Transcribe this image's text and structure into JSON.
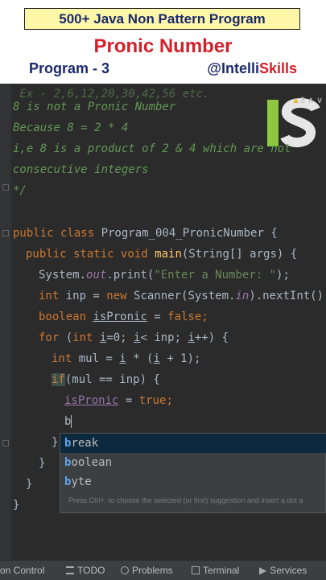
{
  "banner": {
    "series_title": "500+ Java Non Pattern Program",
    "topic_title": "Pronic Number",
    "program_label": "Program - 3",
    "handle_prefix": "@Intelli",
    "handle_suffix": "Skills"
  },
  "editor": {
    "comment_lines": [
      "8 is not a Pronic Number",
      "Because 8 = 2 * 4",
      "i,e 8 is a product of 2 & 4 which are not",
      "consecutive integers",
      "*/"
    ],
    "code": {
      "class_kw": "public class ",
      "class_name": "Program_004_PronicNumber {",
      "main_kw": "public static void ",
      "main_name": "main",
      "main_args": "(String[] args) {",
      "print_obj": "System.",
      "print_field": "out",
      "print_call": ".print(",
      "print_str": "\"Enter a Number: \"",
      "print_end": ");",
      "int_kw": "int ",
      "inp_decl": "inp = ",
      "new_kw": "new ",
      "scanner": "Scanner(System.",
      "in_field": "in",
      "scanner_end": ").nextInt();",
      "bool_kw": "boolean ",
      "is_pronic": "isPronic",
      "eq": " = ",
      "false_kw": "false",
      "semi": ";",
      "for_kw": "for ",
      "for_open": "(",
      "for_int": "int ",
      "for_i": "i",
      "for_init": "=0; ",
      "for_cond": "< inp; ",
      "for_inc": "++) {",
      "mul_decl": "mul = ",
      "mul_i": "i",
      "mul_rest1": " * (",
      "mul_i2": "i",
      "mul_rest2": " + 1);",
      "if_kw": "if",
      "if_cond": "(mul == inp) {",
      "assign_var": "isPronic",
      "assign_eq": " = ",
      "true_kw": "true",
      "assign_end": ";",
      "typed": "b",
      "close_brace": "}"
    },
    "badge_count": "3",
    "logo_text": "IS"
  },
  "autocomplete": {
    "items": [
      {
        "match": "b",
        "rest": "reak"
      },
      {
        "match": "b",
        "rest": "oolean"
      },
      {
        "match": "b",
        "rest": "yte"
      }
    ],
    "hint": "Press Ctrl+. to choose the selected (or first) suggestion and insert a dot a"
  },
  "statusbar": {
    "items": [
      "on Control",
      "TODO",
      "Problems",
      "Terminal",
      "Services"
    ]
  }
}
